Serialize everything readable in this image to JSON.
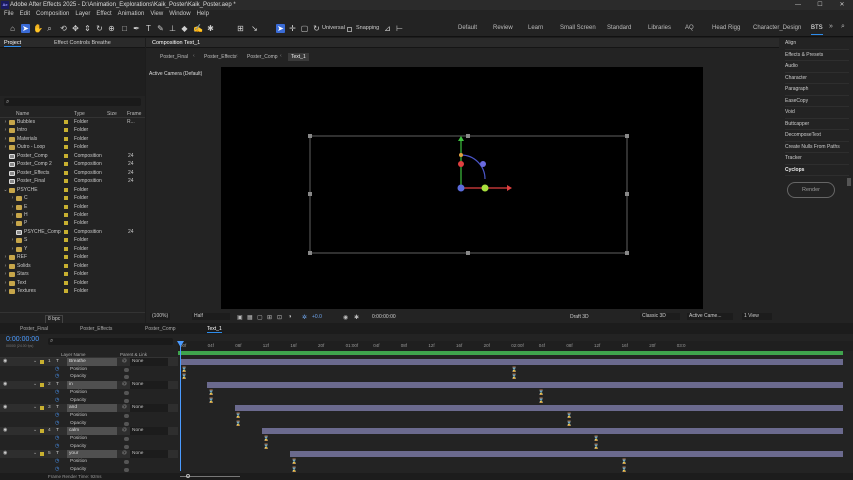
{
  "titlebar": {
    "text": "Adobe After Effects 2025 - D:\\Animation_Explorations\\Kaik_Poster\\Kaik_Poster.aep *",
    "logo": "Ae",
    "minimize": "—",
    "maximize": "☐",
    "close": "✕"
  },
  "menu": [
    "File",
    "Edit",
    "Composition",
    "Layer",
    "Effect",
    "Animation",
    "View",
    "Window",
    "Help"
  ],
  "toolbar": {
    "universal_label": "Universal",
    "snapping_label": "Snapping",
    "workspaces": [
      "Default",
      "Review",
      "Learn",
      "Small Screen",
      "Standard",
      "Libraries",
      "AQ",
      "Head Rigg",
      "Character_Design",
      "BTS"
    ],
    "active_workspace": "BTS"
  },
  "project": {
    "tab_project": "Project",
    "tab_effect_controls": "Effect Controls Breathe",
    "search_placeholder": "",
    "columns": {
      "name": "Name",
      "type": "Type",
      "size": "Size",
      "frame_rate": "Frame R..."
    },
    "items": [
      {
        "name": "Bubbles",
        "type": "Folder",
        "fr": "",
        "kind": "folder",
        "depth": 0,
        "expanded": false
      },
      {
        "name": "Intro",
        "type": "Folder",
        "fr": "",
        "kind": "folder",
        "depth": 0,
        "expanded": false
      },
      {
        "name": "Materials",
        "type": "Folder",
        "fr": "",
        "kind": "folder",
        "depth": 0,
        "expanded": false
      },
      {
        "name": "Outro - Loop",
        "type": "Folder",
        "fr": "",
        "kind": "folder",
        "depth": 0,
        "expanded": false
      },
      {
        "name": "Poster_Comp",
        "type": "Composition",
        "fr": "24",
        "kind": "comp",
        "depth": 0,
        "expanded": false
      },
      {
        "name": "Poster_Comp 2",
        "type": "Composition",
        "fr": "24",
        "kind": "comp",
        "depth": 0,
        "expanded": false
      },
      {
        "name": "Poster_Effects",
        "type": "Composition",
        "fr": "24",
        "kind": "comp",
        "depth": 0,
        "expanded": false
      },
      {
        "name": "Poster_Final",
        "type": "Composition",
        "fr": "24",
        "kind": "comp",
        "depth": 0,
        "expanded": false
      },
      {
        "name": "PSYCHE",
        "type": "Folder",
        "fr": "",
        "kind": "folder",
        "depth": 0,
        "expanded": true
      },
      {
        "name": "C",
        "type": "Folder",
        "fr": "",
        "kind": "folder",
        "depth": 1,
        "expanded": false
      },
      {
        "name": "E",
        "type": "Folder",
        "fr": "",
        "kind": "folder",
        "depth": 1,
        "expanded": false
      },
      {
        "name": "H",
        "type": "Folder",
        "fr": "",
        "kind": "folder",
        "depth": 1,
        "expanded": false
      },
      {
        "name": "P",
        "type": "Folder",
        "fr": "",
        "kind": "folder",
        "depth": 1,
        "expanded": false
      },
      {
        "name": "PSYCHE_Comp",
        "type": "Composition",
        "fr": "24",
        "kind": "comp",
        "depth": 1,
        "expanded": false
      },
      {
        "name": "S",
        "type": "Folder",
        "fr": "",
        "kind": "folder",
        "depth": 1,
        "expanded": false
      },
      {
        "name": "Y",
        "type": "Folder",
        "fr": "",
        "kind": "folder",
        "depth": 1,
        "expanded": false
      },
      {
        "name": "REF",
        "type": "Folder",
        "fr": "",
        "kind": "folder",
        "depth": 0,
        "expanded": false
      },
      {
        "name": "Solids",
        "type": "Folder",
        "fr": "",
        "kind": "folder",
        "depth": 0,
        "expanded": false
      },
      {
        "name": "Stars",
        "type": "Folder",
        "fr": "",
        "kind": "folder",
        "depth": 0,
        "expanded": false
      },
      {
        "name": "Text",
        "type": "Folder",
        "fr": "",
        "kind": "folder",
        "depth": 0,
        "expanded": false
      },
      {
        "name": "Textures",
        "type": "Folder",
        "fr": "",
        "kind": "folder",
        "depth": 0,
        "expanded": false
      }
    ],
    "bpc": "8 bpc"
  },
  "viewer": {
    "panel_title": "Composition Text_1",
    "breadcrumbs": [
      "Poster_Final",
      "Poster_Effects",
      "Poster_Comp",
      "Text_1"
    ],
    "camera_label": "Active Camera (Default)",
    "zoom": "(100%)",
    "resolution": "Half",
    "exposure": "+0.0",
    "timecode": "0:00:00:00",
    "draft3d": "Draft 3D",
    "renderer": "Classic 3D",
    "camera": "Active Came...",
    "views": "1 View"
  },
  "right_panel": {
    "items": [
      "Align",
      "Effects & Presets",
      "Audio",
      "Character",
      "Paragraph",
      "EaseCopy",
      "Void",
      "Buttcapper",
      "DecomposeText",
      "Create Nulls From Paths",
      "Tracker",
      "Cyclops"
    ],
    "render_button": "Render"
  },
  "timeline": {
    "tabs": [
      "Poster_Final",
      "Poster_Effects",
      "Poster_Comp",
      "Text_1"
    ],
    "active_tab": "Text_1",
    "timecode": "0:00:00:00",
    "timecode_sub": "00000 (24.00 fps)",
    "col_layer_name": "Layer Name",
    "col_parent": "Parent & Link",
    "ruler": [
      "00f",
      "04f",
      "08f",
      "12f",
      "16f",
      "20f",
      "01:00f",
      "04f",
      "08f",
      "12f",
      "16f",
      "20f",
      "02:00f",
      "04f",
      "08f",
      "12f",
      "16f",
      "20f",
      "03:0"
    ],
    "layers": [
      {
        "num": "1",
        "name": "Breathe",
        "parent": "None"
      },
      {
        "num": "2",
        "name": "in",
        "parent": "None"
      },
      {
        "num": "3",
        "name": "and",
        "parent": "None"
      },
      {
        "num": "4",
        "name": "calm",
        "parent": "None"
      },
      {
        "num": "5",
        "name": "your",
        "parent": "None"
      }
    ],
    "props": [
      "Position",
      "Opacity"
    ],
    "render_time": "Frame Render Time: 92ms"
  }
}
